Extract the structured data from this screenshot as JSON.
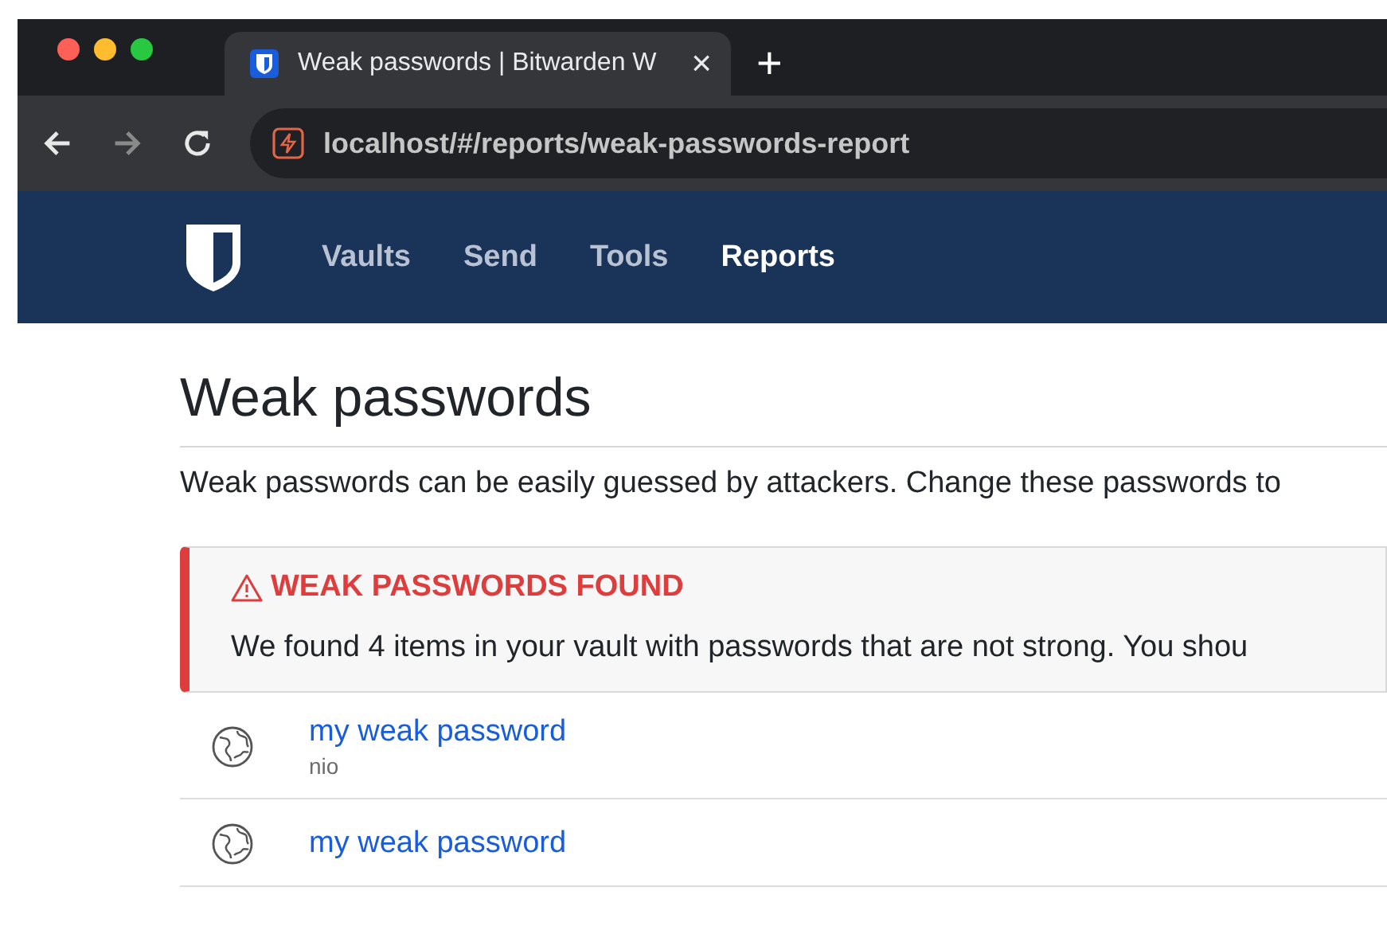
{
  "browser": {
    "tab": {
      "title": "Weak passwords | Bitwarden W",
      "close": "×"
    },
    "new_tab": "+",
    "address": "localhost/#/reports/weak-passwords-report"
  },
  "nav": {
    "items": [
      {
        "label": "Vaults",
        "selected": false
      },
      {
        "label": "Send",
        "selected": false
      },
      {
        "label": "Tools",
        "selected": false
      },
      {
        "label": "Reports",
        "selected": true
      }
    ]
  },
  "page": {
    "title": "Weak passwords",
    "description": "Weak passwords can be easily guessed by attackers. Change these passwords to"
  },
  "callout": {
    "title": "WEAK PASSWORDS FOUND",
    "body": "We found 4 items in your vault with passwords that are not strong. You shou"
  },
  "items": [
    {
      "name": "my weak password",
      "username": "nio"
    },
    {
      "name": "my weak password"
    }
  ]
}
